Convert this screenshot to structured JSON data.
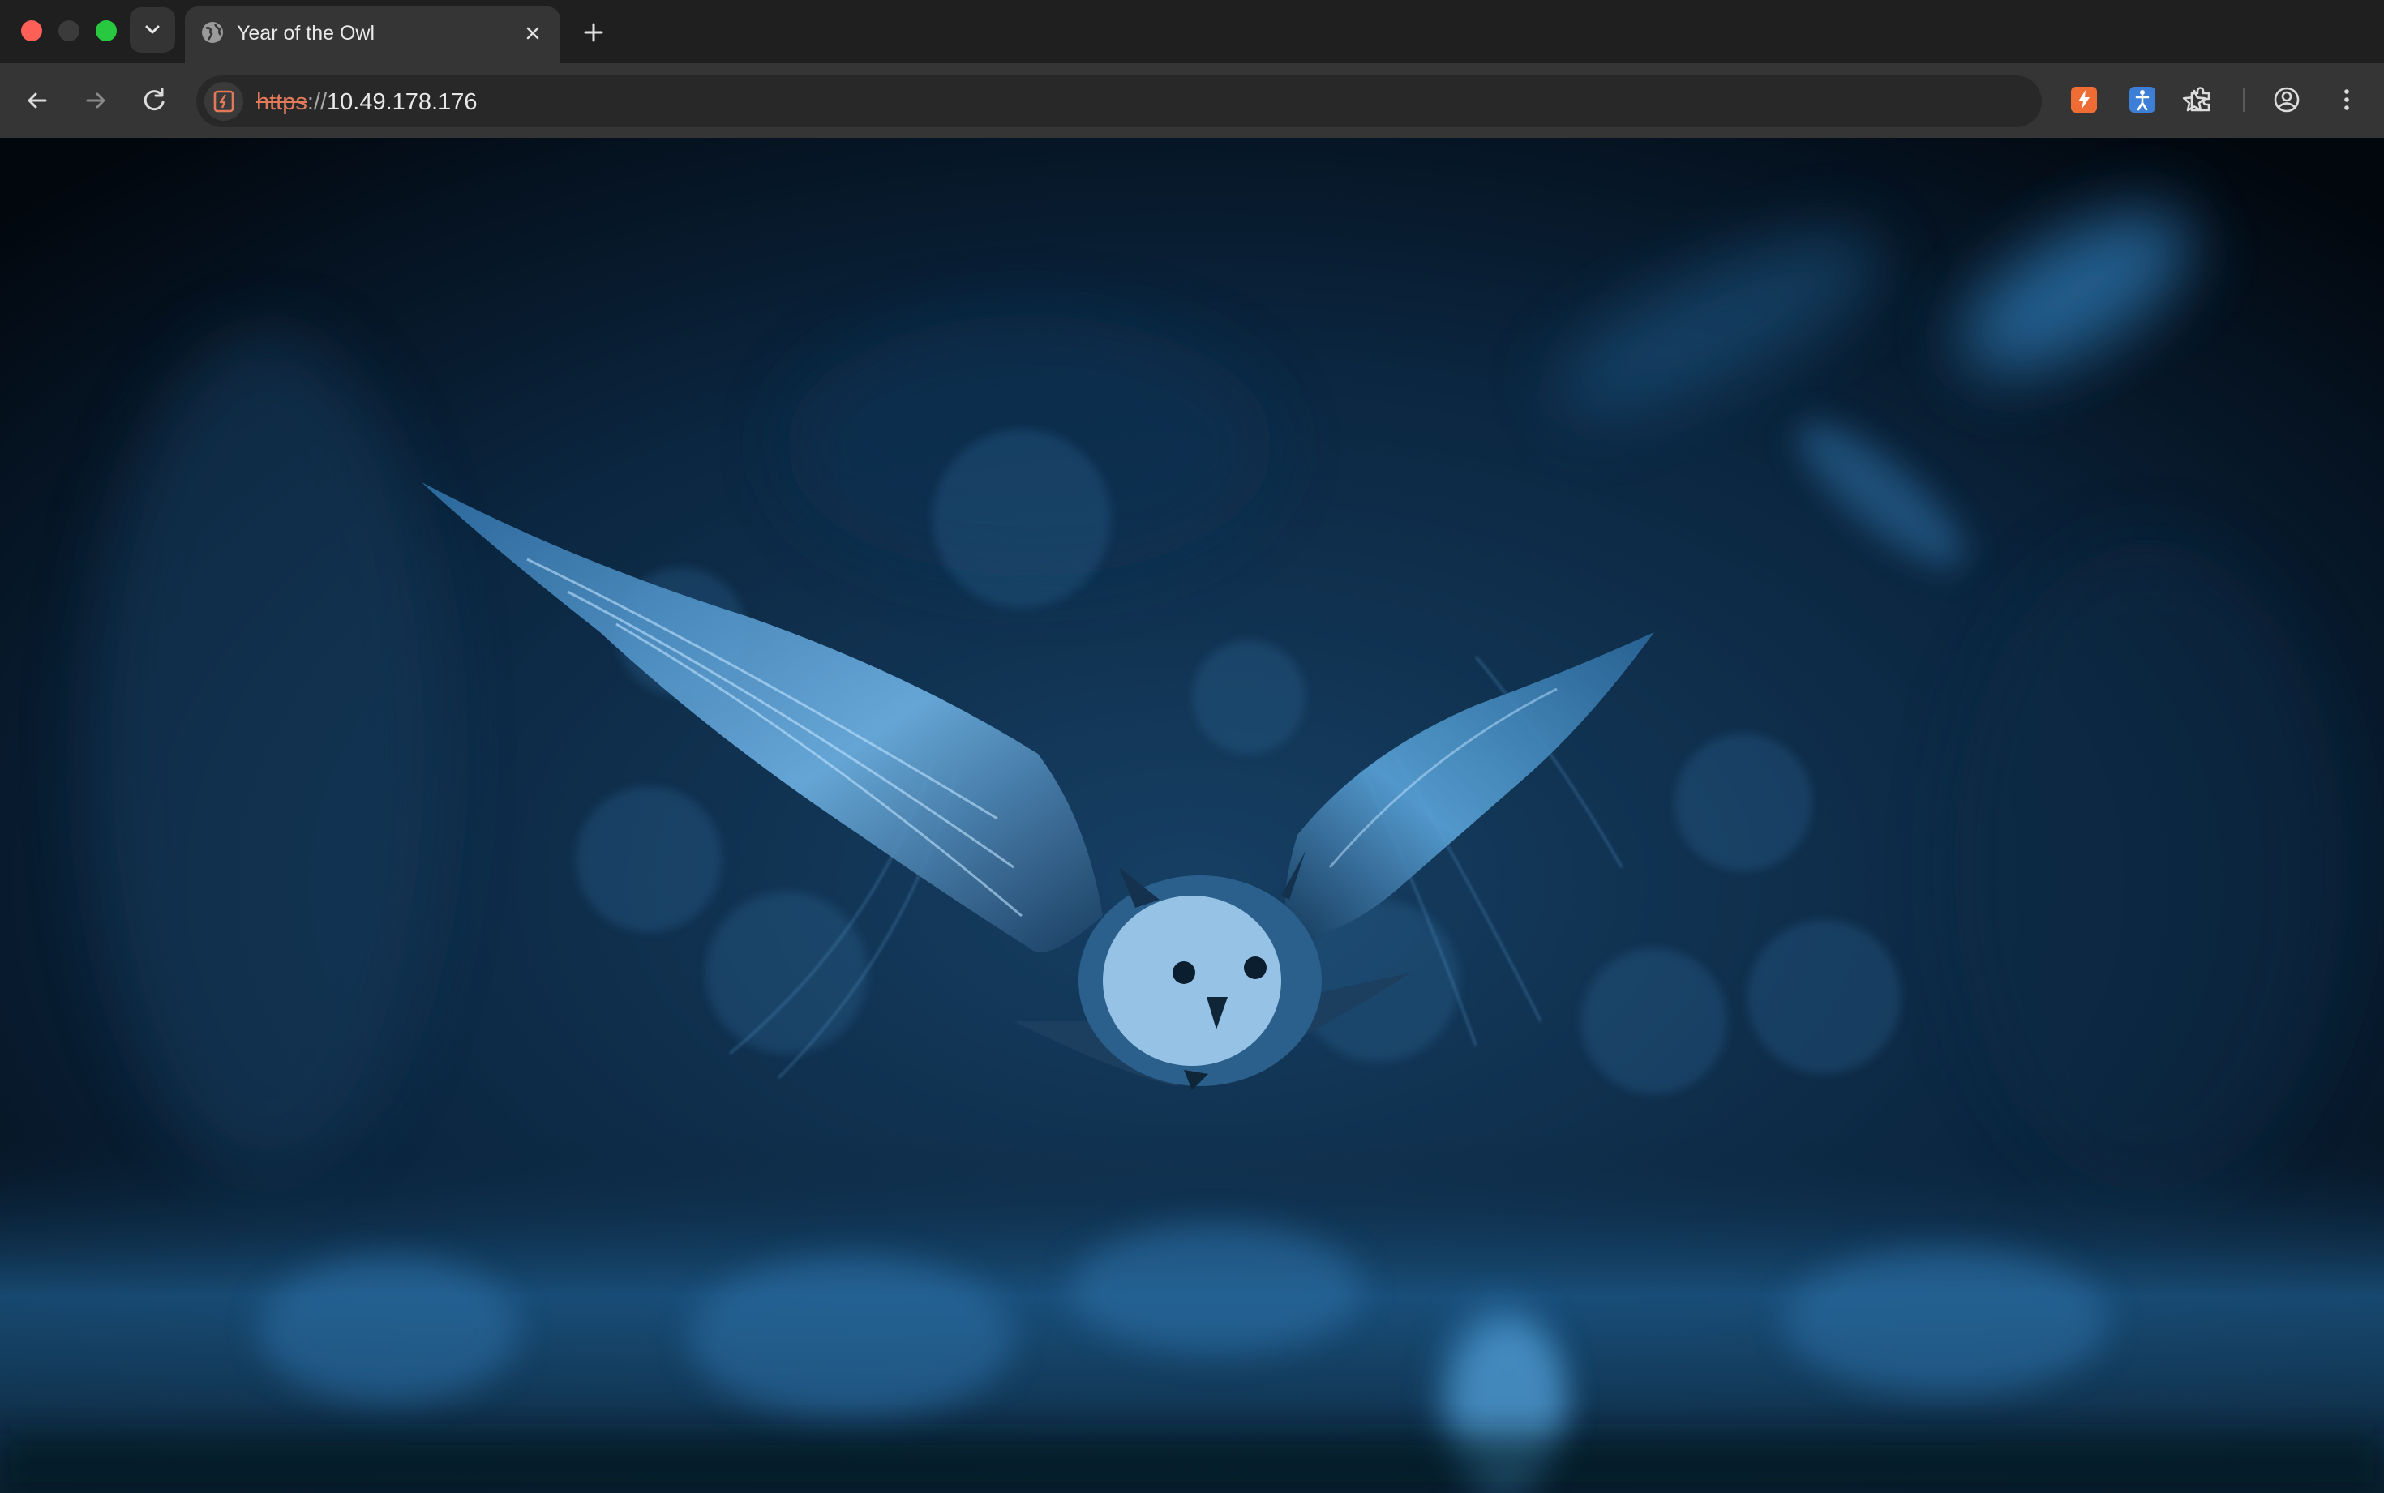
{
  "window": {
    "traffic_lights": [
      "close",
      "minimize",
      "maximize"
    ]
  },
  "tabs": [
    {
      "title": "Year of the Owl",
      "favicon": "globe-icon",
      "active": true
    }
  ],
  "toolbar": {
    "back_icon": "arrow-left-icon",
    "forward_icon": "arrow-right-icon",
    "reload_icon": "reload-icon",
    "url": {
      "scheme": "https",
      "separator": "://",
      "host": "10.49.178.176",
      "scheme_insecure": true
    },
    "extensions": [
      "lightning-extension-icon",
      "accessibility-extension-icon",
      "puzzle-icon"
    ],
    "profile_icon": "profile-icon",
    "menu_icon": "kebab-menu-icon"
  },
  "page": {
    "image": "owl-in-flight-night-background",
    "colors": {
      "deep": "#030b15",
      "mid": "#0f3352",
      "accent": "#3a7fb8",
      "highlight": "#9fd0f4"
    }
  }
}
